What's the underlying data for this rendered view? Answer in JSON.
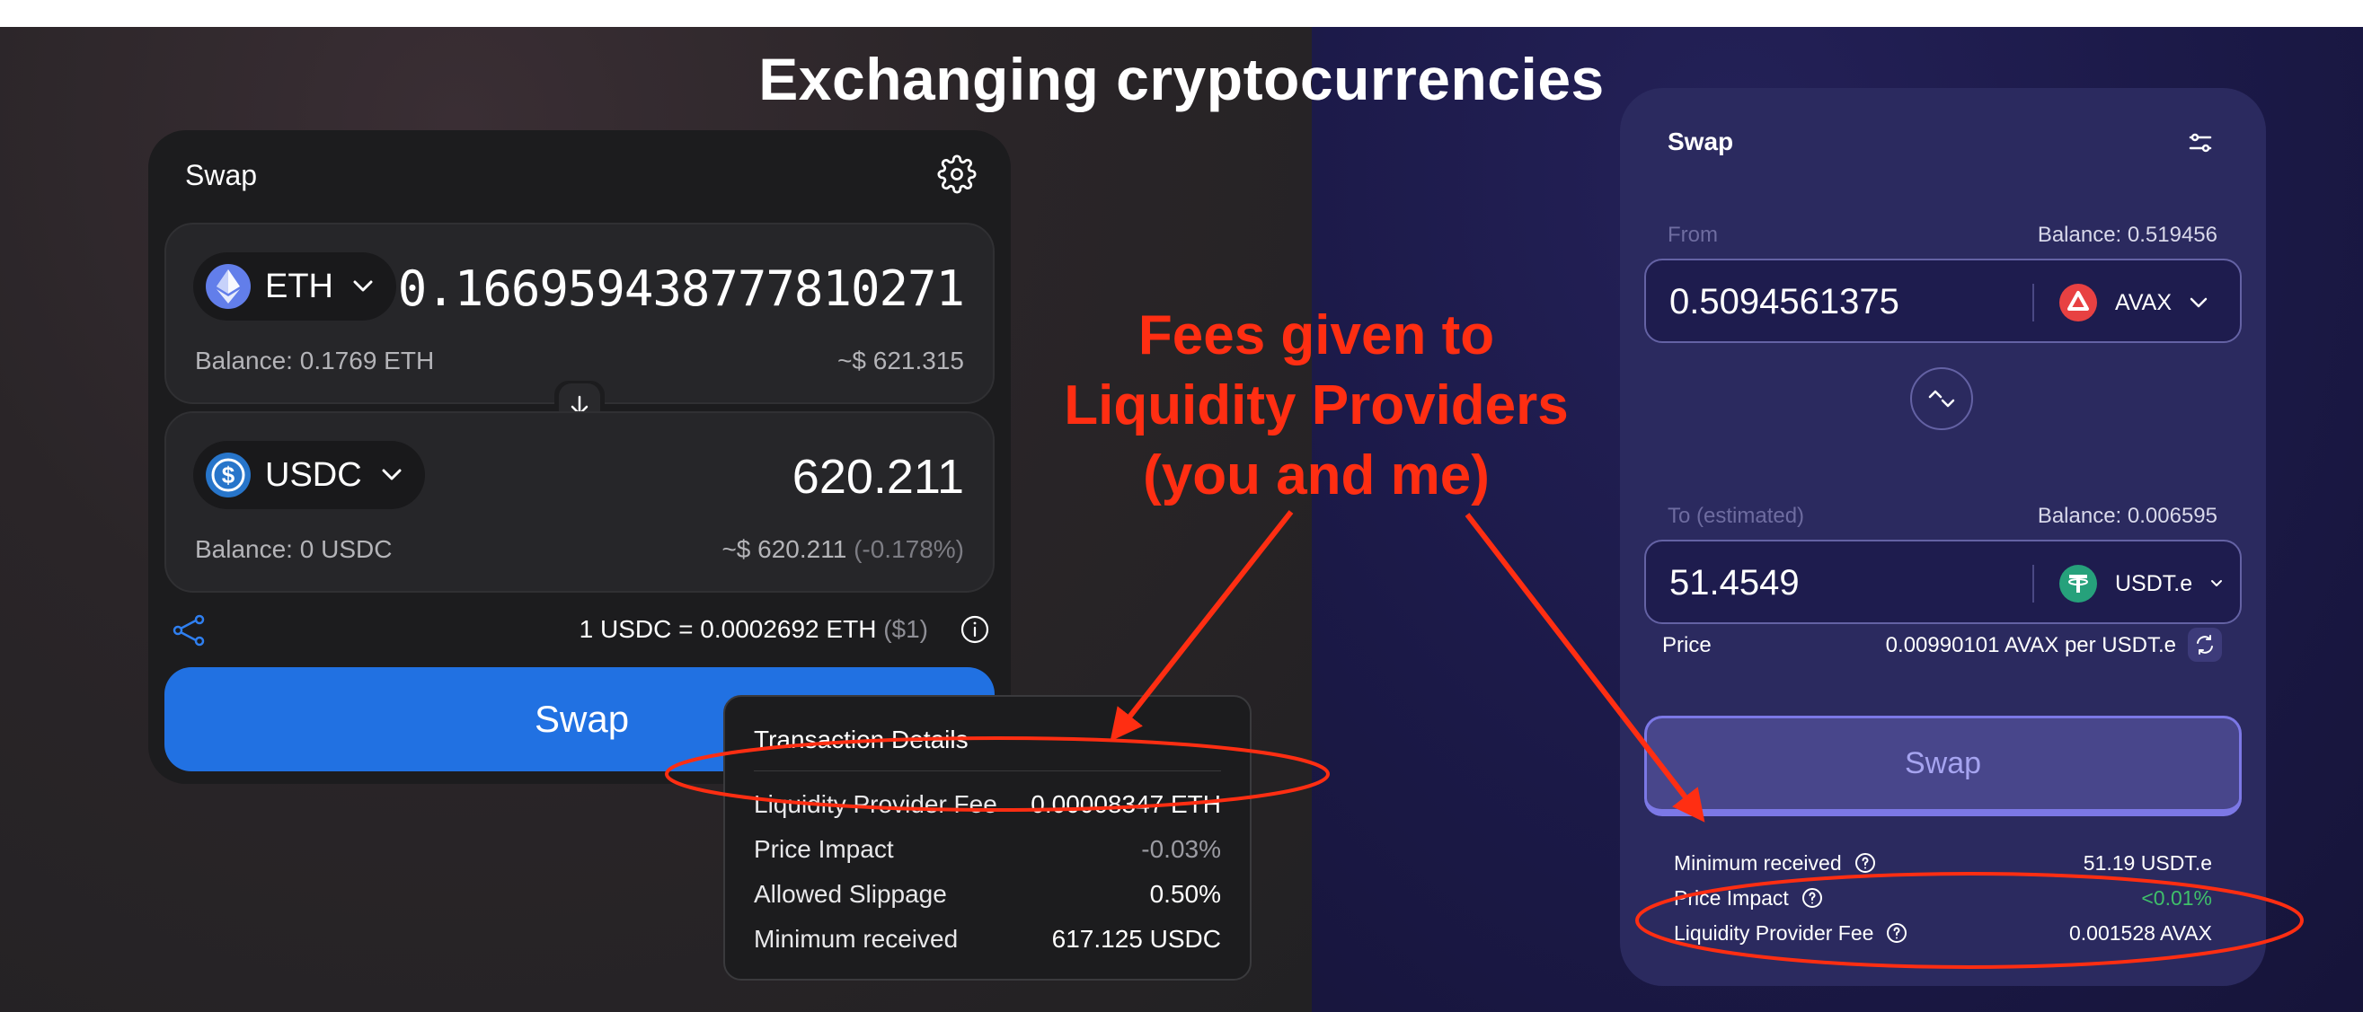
{
  "page_title": "Exchanging cryptocurrencies",
  "left_swap": {
    "header": "Swap",
    "from": {
      "token": "ETH",
      "amount": "0.166959438777810271",
      "balance": "Balance: 0.1769 ETH",
      "usd": "~$ 621.315"
    },
    "to": {
      "token": "USDC",
      "amount": "620.211",
      "balance": "Balance: 0 USDC",
      "usd": "~$ 620.211",
      "usd_change": "(-0.178%)"
    },
    "rate": "1 USDC = 0.0002692 ETH",
    "rate_usd": "($1)",
    "swap_button": "Swap",
    "tooltip": {
      "title": "Transaction Details",
      "rows": [
        {
          "label": "Liquidity Provider Fee",
          "value": "0.00008347 ETH"
        },
        {
          "label": "Price Impact",
          "value": "-0.03%"
        },
        {
          "label": "Allowed Slippage",
          "value": "0.50%"
        },
        {
          "label": "Minimum received",
          "value": "617.125 USDC"
        }
      ]
    }
  },
  "annotation": {
    "line1": "Fees given to",
    "line2": "Liquidity Providers",
    "line3": "(you and me)",
    "color": "#ff2e12"
  },
  "right_swap": {
    "header": "Swap",
    "from_label": "From",
    "from_balance": "Balance: 0.519456",
    "from_amount": "0.5094561375",
    "from_token": "AVAX",
    "to_label": "To (estimated)",
    "to_balance": "Balance: 0.006595",
    "to_amount": "51.4549",
    "to_token": "USDT.e",
    "price_label": "Price",
    "price_value": "0.00990101 AVAX per USDT.e",
    "swap_button": "Swap",
    "details": [
      {
        "label": "Minimum received",
        "value": "51.19 USDT.e"
      },
      {
        "label": "Price Impact",
        "value": "<0.01%"
      },
      {
        "label": "Liquidity Provider Fee",
        "value": "0.001528 AVAX"
      }
    ]
  },
  "colors": {
    "swap_blue": "#2171e2",
    "eth": "#627eea",
    "usdc": "#2775ca",
    "avax": "#e84142",
    "usdt": "#26a17b",
    "green": "#3fbf6a"
  }
}
